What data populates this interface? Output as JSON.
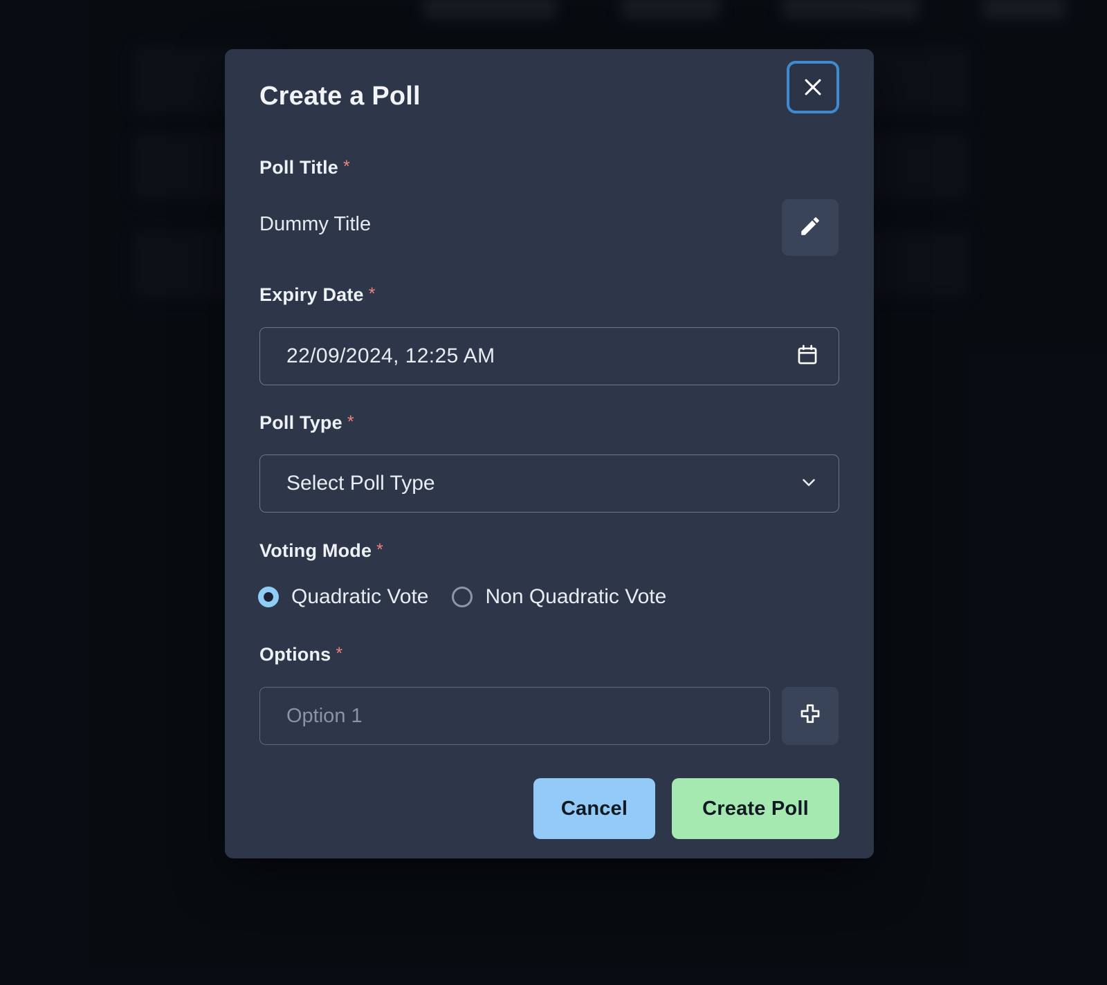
{
  "background": {
    "nav_items": [
      "",
      "",
      "",
      ""
    ],
    "card_count": 6
  },
  "modal": {
    "title": "Create a Poll",
    "close_icon": "close-icon",
    "fields": {
      "poll_title": {
        "label": "Poll Title",
        "required_marker": "*",
        "value": "Dummy Title",
        "edit_icon": "pencil-icon"
      },
      "expiry_date": {
        "label": "Expiry Date",
        "required_marker": "*",
        "value": "22/09/2024, 12:25 AM",
        "calendar_icon": "calendar-icon"
      },
      "poll_type": {
        "label": "Poll Type",
        "required_marker": "*",
        "selected": "Select Poll Type",
        "chevron_icon": "chevron-down-icon"
      },
      "voting_mode": {
        "label": "Voting Mode",
        "required_marker": "*",
        "options": [
          {
            "label": "Quadratic Vote",
            "selected": true
          },
          {
            "label": "Non Quadratic Vote",
            "selected": false
          }
        ]
      },
      "options": {
        "label": "Options",
        "required_marker": "*",
        "inputs": [
          {
            "value": "",
            "placeholder": "Option 1"
          }
        ],
        "add_icon": "plus-icon"
      }
    },
    "footer": {
      "cancel_label": "Cancel",
      "create_label": "Create Poll"
    }
  },
  "colors": {
    "modal_bg": "#2E3749",
    "page_bg": "#0C1016",
    "focus_ring": "#3F8AD0",
    "required_star": "#F08080",
    "cancel_bg": "#93CAF8",
    "create_bg": "#A5E9B0",
    "radio_selected": "#8FCDF5",
    "input_border": "#6D7890",
    "icon_button_bg": "#3A4458"
  }
}
